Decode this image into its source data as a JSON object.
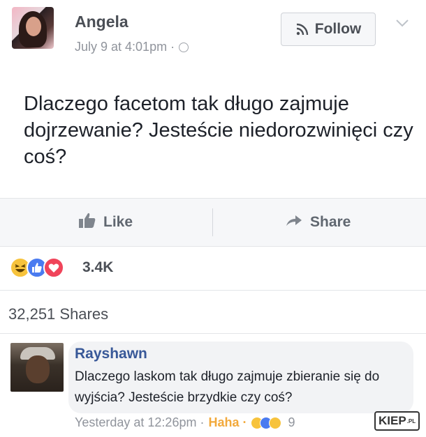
{
  "post": {
    "author": "Angela",
    "timestamp": "July 9 at 4:01pm ·",
    "follow_label": "Follow",
    "text": "Dlaczego facetom tak długo zajmuje dojrzewanie? Jesteście niedorozwinięci czy coś?"
  },
  "actions": {
    "like_label": "Like",
    "share_label": "Share"
  },
  "reactions": {
    "count": "3.4K",
    "icons": [
      "haha-reaction-icon",
      "like-reaction-icon",
      "love-reaction-icon"
    ]
  },
  "shares": "32,251 Shares",
  "comment": {
    "author": "Rayshawn",
    "text": "Dlaczego laskom tak długo zajmuje zbieranie się do wyjścia? Jesteście brzydkie czy coś?",
    "timestamp": "Yesterday at 12:26pm ·",
    "reaction_label": "Haha ·",
    "reaction_count": "9"
  },
  "watermark": {
    "name": "KIEP",
    "suffix": ".PL"
  },
  "colors": {
    "link_blue": "#385898",
    "meta_gray": "#90949c",
    "action_gray": "#606770",
    "bubble": "#f2f3f5",
    "haha": "#f7c33c",
    "like": "#4a7bf0",
    "love": "#f0445a"
  }
}
